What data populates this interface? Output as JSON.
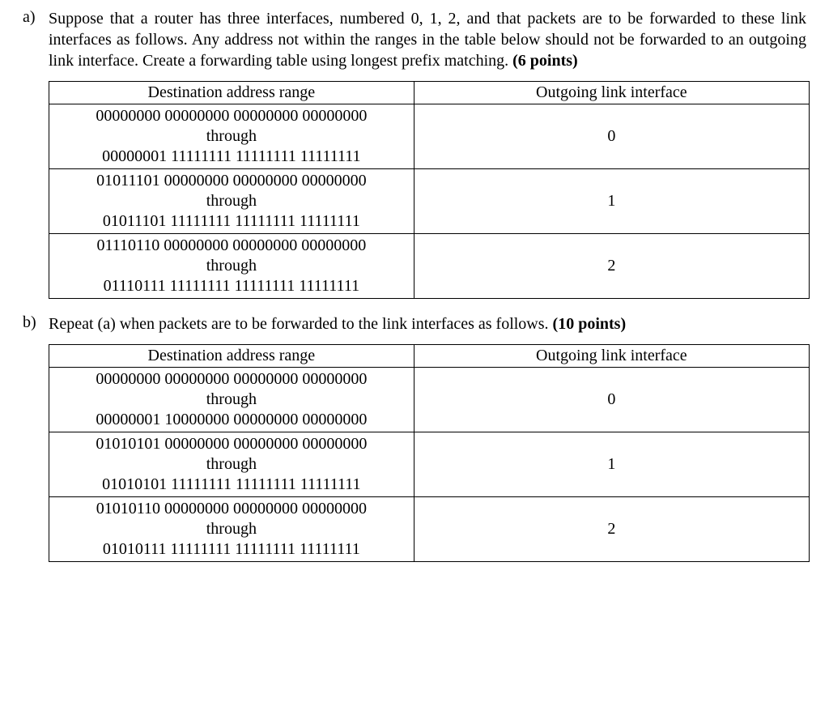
{
  "questions": {
    "a": {
      "label": "a)",
      "text_pre": "Suppose that a router has three interfaces, numbered 0, 1, 2, and that packets are to be forwarded to these link interfaces as follows. Any address not within the ranges in the table below should not be forwarded to an outgoing link interface. Create a forwarding table using longest prefix matching. ",
      "points": "(6 points)"
    },
    "b": {
      "label": "b)",
      "text_pre": "Repeat (a) when packets are to be forwarded to the link interfaces as follows. ",
      "points": "(10 points)"
    }
  },
  "table_headers": {
    "dest": "Destination address range",
    "intf": "Outgoing link interface"
  },
  "table_a": {
    "rows": [
      {
        "addr_from": "00000000 00000000 00000000 00000000",
        "mid": "through",
        "addr_to": "00000001 11111111 11111111 11111111",
        "interface": "0"
      },
      {
        "addr_from": "01011101 00000000 00000000 00000000",
        "mid": "through",
        "addr_to": "01011101 11111111 11111111 11111111",
        "interface": "1"
      },
      {
        "addr_from": "01110110 00000000 00000000 00000000",
        "mid": "through",
        "addr_to": "01110111 11111111 11111111 11111111",
        "interface": "2"
      }
    ]
  },
  "table_b": {
    "rows": [
      {
        "addr_from": "00000000 00000000 00000000 00000000",
        "mid": "through",
        "addr_to": "00000001 10000000 00000000 00000000",
        "interface": "0"
      },
      {
        "addr_from": "01010101 00000000 00000000 00000000",
        "mid": "through",
        "addr_to": "01010101 11111111 11111111 11111111",
        "interface": "1"
      },
      {
        "addr_from": "01010110 00000000 00000000 00000000",
        "mid": "through",
        "addr_to": "01010111 11111111 11111111 11111111",
        "interface": "2"
      }
    ]
  }
}
